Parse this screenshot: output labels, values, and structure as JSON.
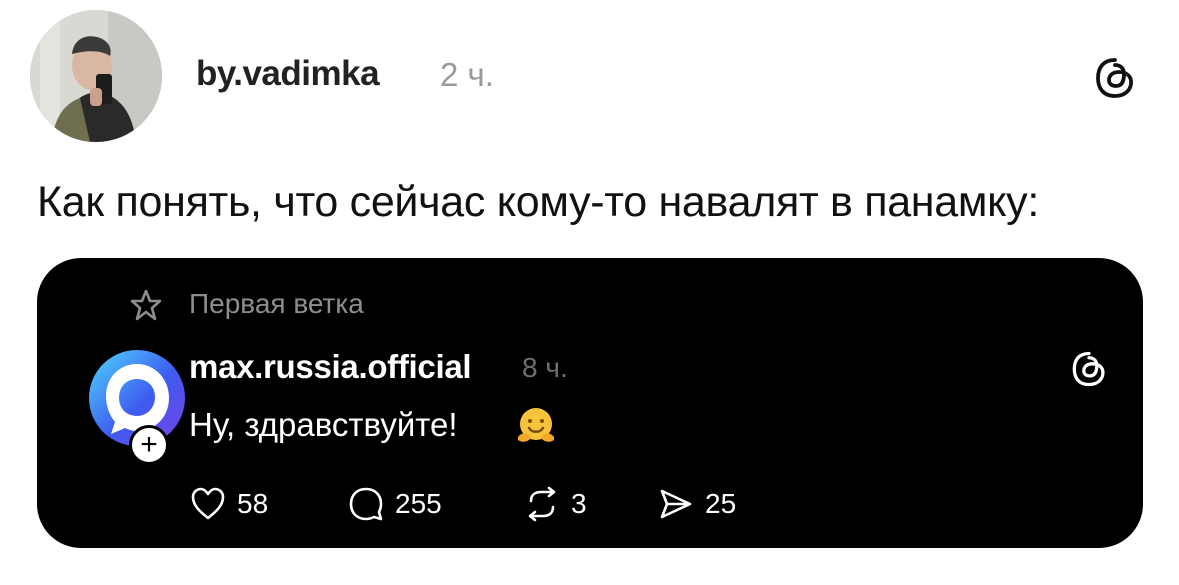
{
  "post": {
    "author": "by.vadimka",
    "time": "2 ч.",
    "text": "Как понять, что сейчас кому-то навалят в панамку:",
    "avatar_icon": "user-photo",
    "logo_icon": "threads-logo"
  },
  "quoted_post": {
    "thread_label": "Первая ветка",
    "author": "max.russia.official",
    "time": "8 ч.",
    "text": "Ну, здравствуйте!",
    "emoji": "hugging-face-emoji",
    "follow_symbol": "+",
    "stats": {
      "likes": "58",
      "replies": "255",
      "reposts": "3",
      "shares": "25"
    }
  },
  "colors": {
    "card_background": "#000000",
    "brand_gradient_start": "#4fd7ff",
    "brand_gradient_end": "#7b3fe4"
  }
}
